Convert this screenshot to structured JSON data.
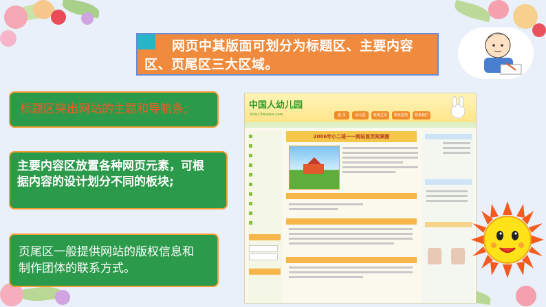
{
  "title": "网页中其版面可划分为标题区、主要内容区、页尾区三大区域。",
  "box1": "标题区突出网站的主题和导航条;",
  "box2": "主要内容区放置各种网页元素，可根据内容的设计划分不同的板块;",
  "box3": "页尾区一般提供网站的版权信息和制作团体的联系方式。",
  "screenshot": {
    "logo": "中国人幼儿园",
    "logo_sub": "Kids.Chinakue.com",
    "banner": "2006年小二班一一网站首页效果图",
    "nav": [
      "首 页",
      "幼儿园",
      "班级主页",
      "家长园地",
      "联系我们"
    ]
  },
  "colors": {
    "title_bg": "#f08a3c",
    "box_bg": "#2c9a4b",
    "box_border": "#f39c30",
    "accent_text": "#f25d23"
  }
}
